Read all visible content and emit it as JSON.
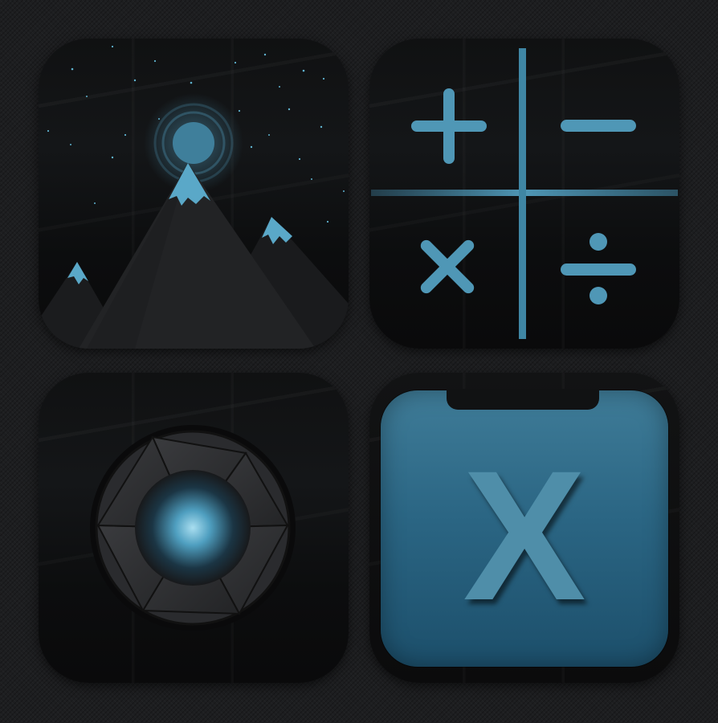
{
  "icons": [
    {
      "id": "photos",
      "glyph": "mountain-moon-icon"
    },
    {
      "id": "calculator",
      "glyph": "calculator-icon"
    },
    {
      "id": "camera",
      "glyph": "camera-shutter-icon"
    },
    {
      "id": "x",
      "glyph": "x-letter-icon",
      "label": "X"
    }
  ],
  "colors": {
    "accent": "#4f97b6",
    "accent_light": "#7cc6df",
    "mountain": "#1e1f21",
    "background": "#1d1e20"
  }
}
